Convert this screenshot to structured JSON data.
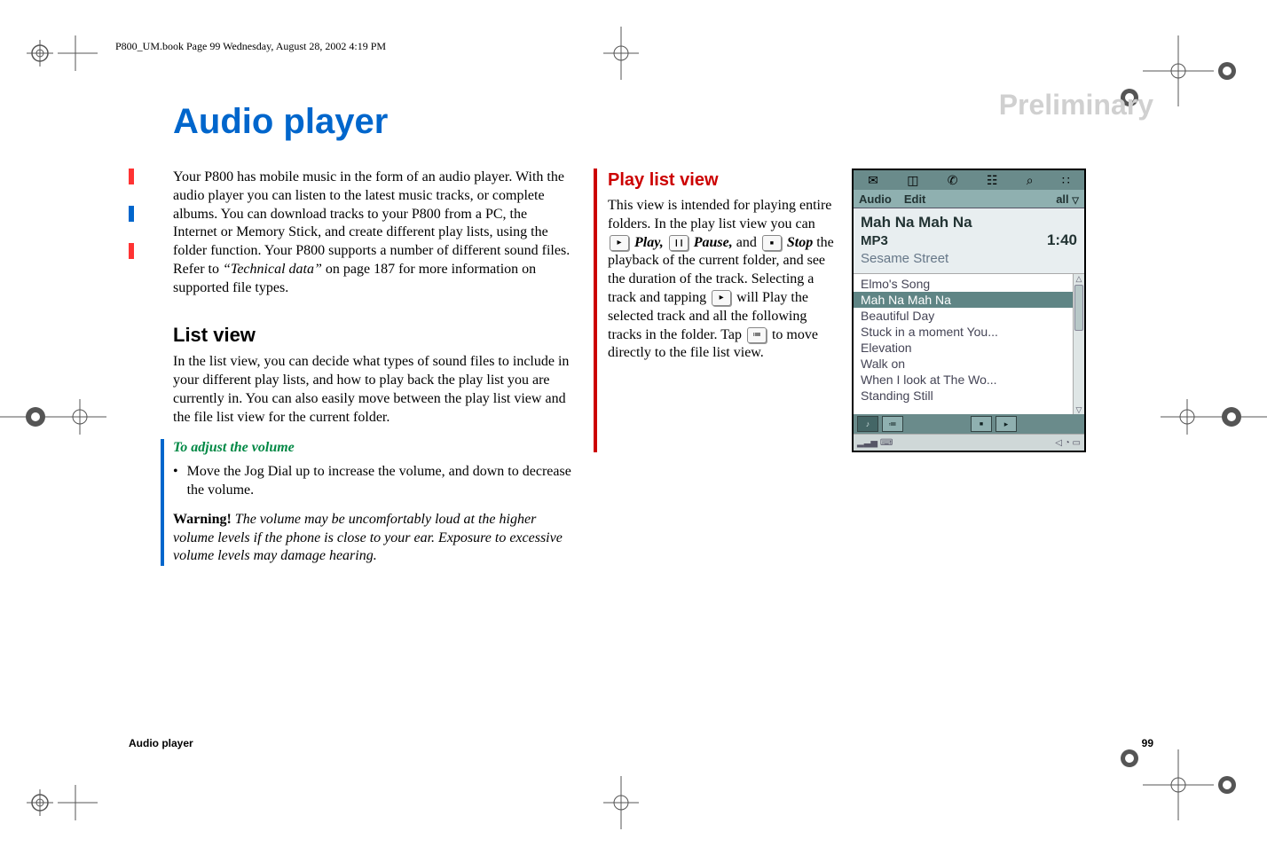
{
  "book_header": "P800_UM.book  Page 99  Wednesday, August 28, 2002  4:19 PM",
  "watermark": "Preliminary",
  "title": "Audio player",
  "col1": {
    "intro": "Your P800 has mobile music in the form of an audio player. With the audio player you can listen to the latest music tracks, or complete albums. You can download tracks to your P800 from a PC, the Internet or Memory Stick, and create different play lists, using the folder function. Your P800 supports a number of different sound files. Refer to ",
    "intro_ref": "“Technical data”",
    "intro_tail": " on page 187 for more information on supported file types.",
    "h2_listview": "List view",
    "listview_p": "In the list view, you can decide what types of sound files to include in your different play lists, and how to play back the play list you are currently in. You can also easily move between the play list view and the file list view for the current folder.",
    "h3_volume": "To adjust the volume",
    "bullet_volume": "Move the Jog Dial up to increase the volume, and down to decrease the volume.",
    "warning_label": "Warning!",
    "warning_text": " The volume may be uncomfortably loud at the higher volume levels if the phone is close to your ear. Exposure to excessive volume levels may damage hearing."
  },
  "col2": {
    "h2_playlist": "Play list view",
    "p1": "This view is intended for playing entire folders. In the play list view you can ",
    "play_label": "Play,",
    "pause_label": "Pause,",
    "and_word": " and ",
    "stop_label": "Stop",
    "p2": " the playback of the current folder, and see the duration of the track. Selecting a track and tapping ",
    "p3": " will Play the selected track and all the following tracks in the folder. Tap ",
    "p4": " to move directly to the file list view."
  },
  "phone": {
    "menubar": {
      "audio": "Audio",
      "edit": "Edit",
      "all": "all"
    },
    "nowplaying": {
      "title": "Mah Na Mah Na",
      "format": "MP3",
      "duration": "1:40",
      "artist": "Sesame Street"
    },
    "playlist": [
      "Elmo's Song",
      "Mah Na Mah Na",
      "Beautiful Day",
      "Stuck in a moment You...",
      "Elevation",
      "Walk on",
      "When I look at The Wo...",
      "Standing Still"
    ],
    "selected_index": 1
  },
  "footer": {
    "left": "Audio player",
    "right": "99"
  },
  "icons": {
    "play": "▸",
    "pause": "❙❙",
    "stop": "■",
    "list": "≔",
    "note": "♪",
    "mail": "✉",
    "book": "◫",
    "phoneic": "✆",
    "cal": "☷",
    "mag": "⌕",
    "apps": "∷",
    "dropdown": "▽",
    "up": "△",
    "down": "▽",
    "signal": "▂▃▅",
    "kb": "⌨",
    "speaker": "◁",
    "clock": "◔",
    "batt": "▭"
  }
}
